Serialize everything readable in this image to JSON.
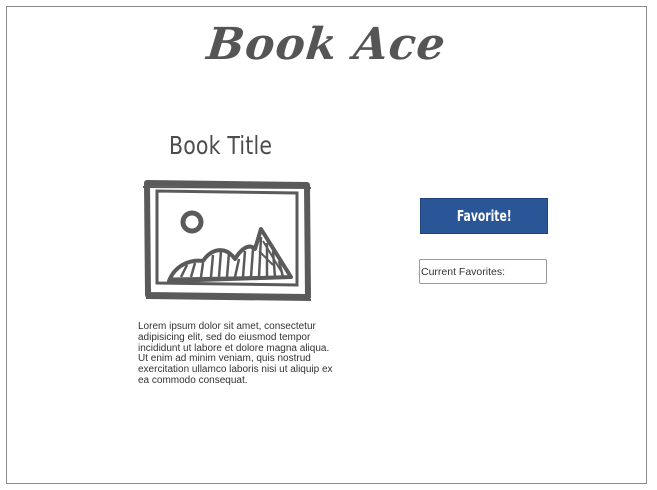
{
  "app": {
    "brand": "Book Ace"
  },
  "book": {
    "title": "Book Title",
    "description": "Lorem ipsum dolor sit amet, consectetur adipisicing elit, sed do eiusmod tempor incididunt ut labore et dolore magna aliqua. Ut enim ad minim veniam, quis nostrud exercitation ullamco laboris nisi ut aliquip ex ea commodo consequat.",
    "cover_icon": "image-placeholder-icon"
  },
  "actions": {
    "favorite_label": "Favorite!",
    "favorite_color": "#2a5597"
  },
  "favorites": {
    "label": "Current Favorites:"
  }
}
